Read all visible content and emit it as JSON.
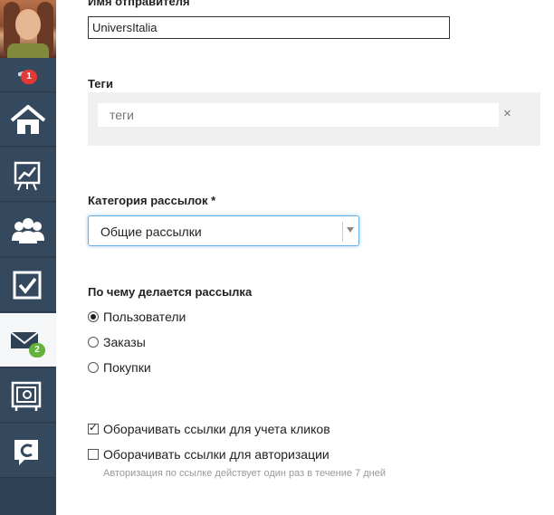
{
  "sidebar": {
    "notifications_count": "1",
    "mail_count": "2",
    "items": [
      {
        "name": "home"
      },
      {
        "name": "analytics"
      },
      {
        "name": "users"
      },
      {
        "name": "tasks"
      },
      {
        "name": "mail",
        "active": true
      },
      {
        "name": "safe"
      },
      {
        "name": "logo"
      }
    ]
  },
  "form": {
    "sender_name_label": "Имя отправителя",
    "sender_name_value": "UniversItalia",
    "tags_label": "Теги",
    "tags_placeholder": "теги",
    "tags_clear": "×",
    "category_label": "Категория рассылок *",
    "category_value": "Общие рассылки",
    "basis_label": "По чему делается рассылка",
    "basis_options": [
      {
        "label": "Пользователи",
        "selected": true
      },
      {
        "label": "Заказы",
        "selected": false
      },
      {
        "label": "Покупки",
        "selected": false
      }
    ],
    "wrap_links_clicks": {
      "label": "Оборачивать ссылки для учета кликов",
      "checked": true
    },
    "wrap_links_auth": {
      "label": "Оборачивать ссылки для авторизации",
      "checked": false
    },
    "auth_hint": "Авторизация по ссылке действует один раз в течение 7 дней"
  },
  "colors": {
    "sidebar": "#34495e",
    "badge_red": "#e53935",
    "badge_green": "#62b23c",
    "focus_border": "#66afe9"
  }
}
